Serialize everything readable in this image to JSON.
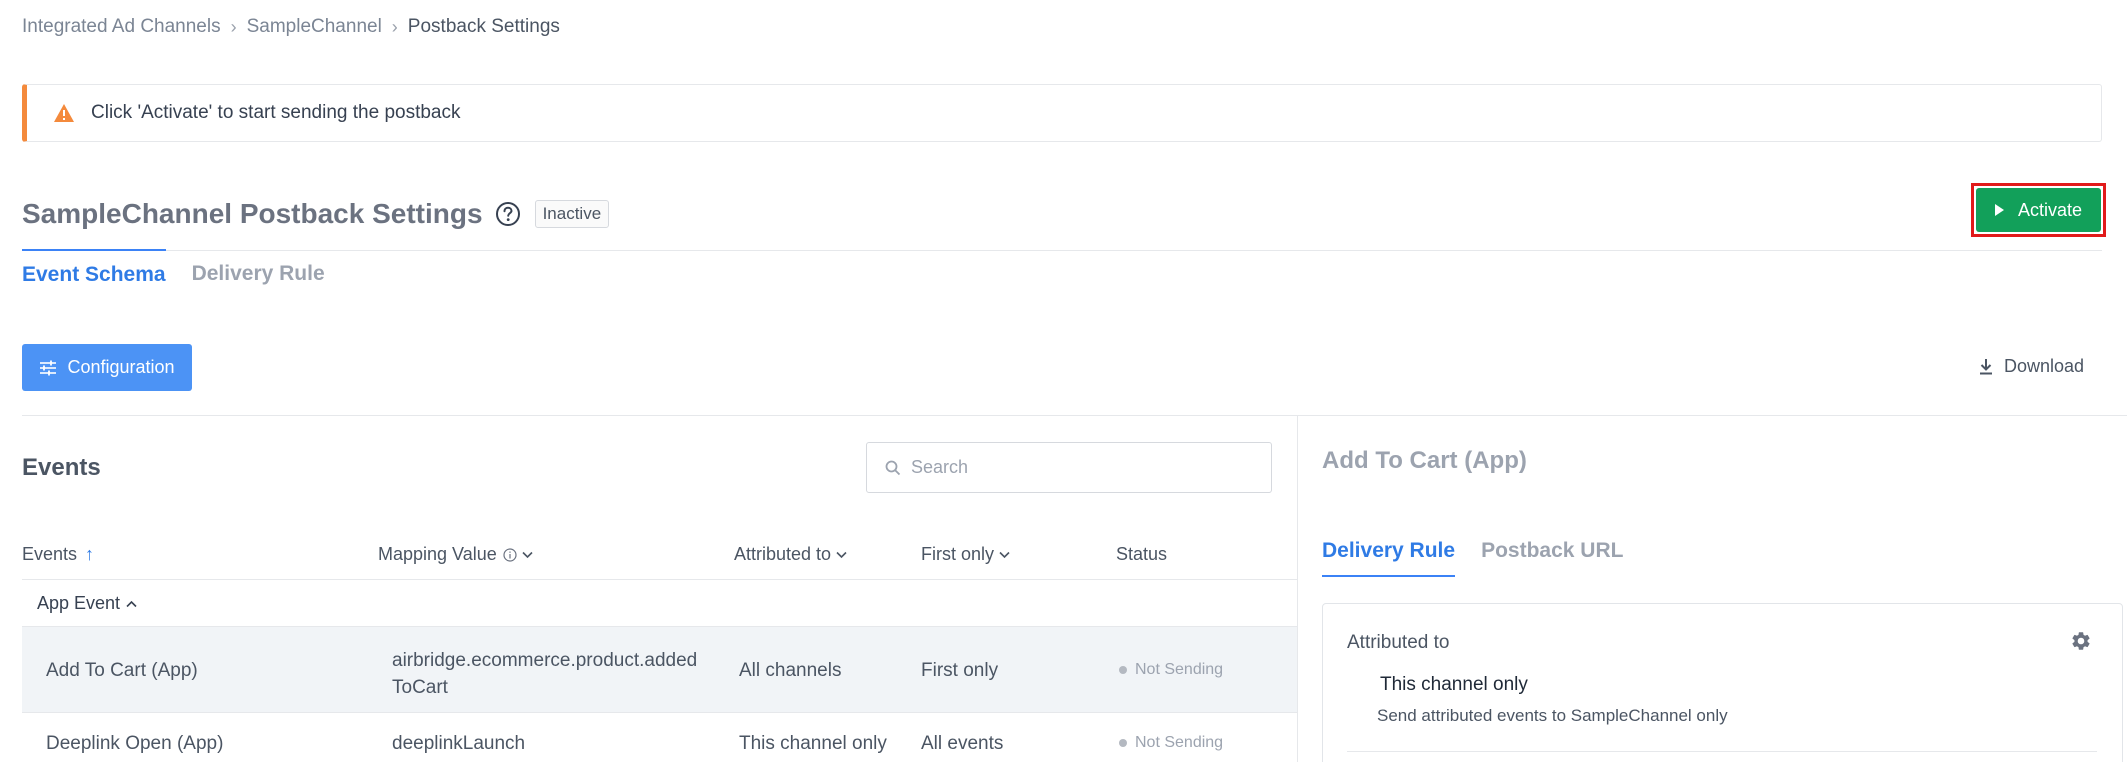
{
  "breadcrumb": {
    "items": [
      "Integrated Ad Channels",
      "SampleChannel",
      "Postback Settings"
    ]
  },
  "alert": {
    "icon": "warning-icon",
    "color": "#f48a3c",
    "text": "Click 'Activate' to start sending the postback"
  },
  "header": {
    "title": "SampleChannel Postback Settings",
    "status": "Inactive",
    "activate_label": "Activate",
    "activate_color": "#12a05a"
  },
  "main_tabs": [
    {
      "label": "Event Schema",
      "active": true
    },
    {
      "label": "Delivery Rule",
      "active": false
    }
  ],
  "toolbar": {
    "configuration_label": "Configuration",
    "download_label": "Download"
  },
  "events": {
    "heading": "Events",
    "search_placeholder": "Search",
    "columns": [
      "Events",
      "Mapping Value",
      "Attributed to",
      "First only",
      "Status"
    ],
    "group": "App Event",
    "rows": [
      {
        "event": "Add To Cart (App)",
        "mapping_line1": "airbridge.ecommerce.product.added",
        "mapping_line2": "ToCart",
        "attributed_to": "All channels",
        "first_only": "First only",
        "status": "Not Sending",
        "selected": true
      },
      {
        "event": "Deeplink Open (App)",
        "mapping_line1": "deeplinkLaunch",
        "mapping_line2": "",
        "attributed_to": "This channel only",
        "first_only": "All events",
        "status": "Not Sending",
        "selected": false
      }
    ]
  },
  "detail": {
    "title": "Add To Cart (App)",
    "tabs": [
      {
        "label": "Delivery Rule",
        "active": true
      },
      {
        "label": "Postback URL",
        "active": false
      }
    ],
    "attributed_label": "Attributed to",
    "attributed_value": "This channel only",
    "attributed_desc": "Send attributed events to SampleChannel only"
  }
}
